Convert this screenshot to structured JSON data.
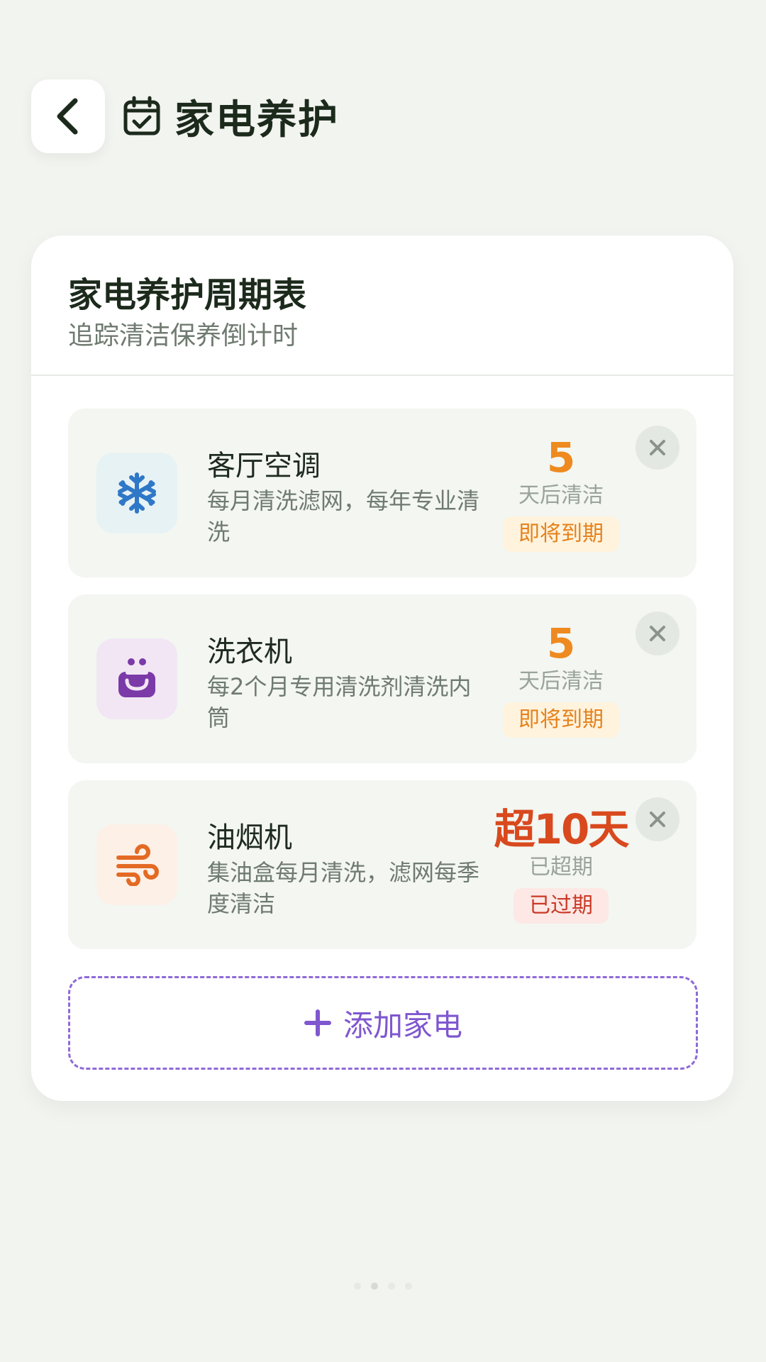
{
  "header": {
    "title": "家电养护",
    "back_icon": "chevron-left-icon",
    "title_icon": "calendar-check-icon"
  },
  "card": {
    "title": "家电养护周期表",
    "subtitle": "追踪清洁保养倒计时"
  },
  "items": [
    {
      "name": "客厅空调",
      "desc": "每月清洗滤网，每年专业清洗",
      "count": "5",
      "count_label": "天后清洁",
      "badge": "即将到期",
      "icon": "snowflake-icon",
      "icon_color": "#2f78c7",
      "icon_bg": "#e7f2f4"
    },
    {
      "name": "洗衣机",
      "desc": "每2个月专用清洗剂清洗内筒",
      "count": "5",
      "count_label": "天后清洁",
      "badge": "即将到期",
      "icon": "washer-icon",
      "icon_color": "#7b3aa8",
      "icon_bg": "#f2e6f4"
    },
    {
      "name": "油烟机",
      "desc": "集油盒每月清洗，滤网每季度清洁",
      "count": "超10天",
      "count_label": "已超期",
      "badge": "已过期",
      "icon": "wind-icon",
      "icon_color": "#e46a24",
      "icon_bg": "#fdf0e7"
    }
  ],
  "add_button": {
    "label": "添加家电",
    "icon": "plus-icon"
  },
  "colors": {
    "soon": "#ee8a1f",
    "overdue": "#d9491e",
    "accent": "#7f57cf"
  }
}
